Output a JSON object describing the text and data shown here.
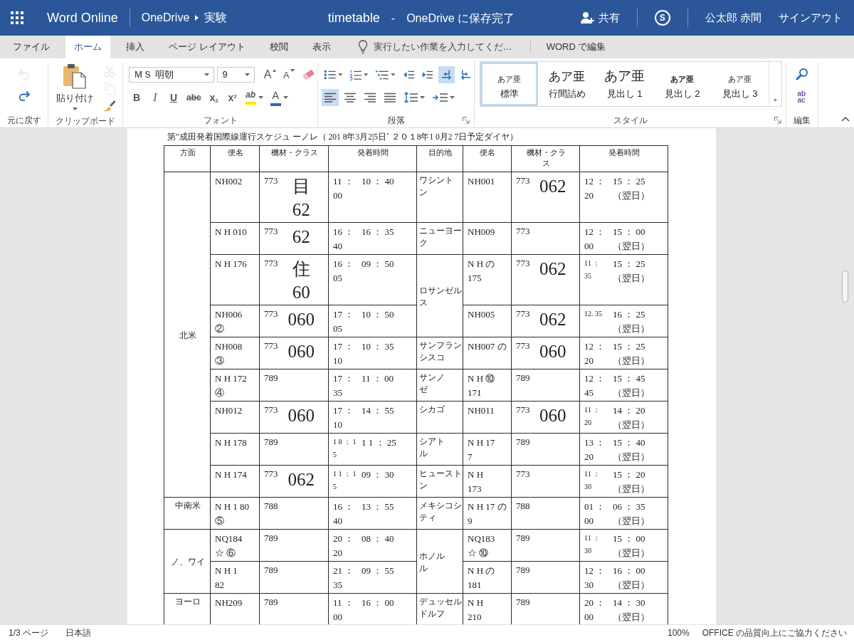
{
  "app_bar": {
    "app_name": "Word Online",
    "breadcrumb": [
      "OneDrive",
      "実験"
    ],
    "document_title": "timetable",
    "title_separator": "-",
    "save_status": "OneDrive に保存完了",
    "share": "共有",
    "chat_glyph": "S",
    "user_name": "公太郎 赤間",
    "sign_out": "サインアウト"
  },
  "tabs": [
    {
      "label": "ファイル",
      "selected": false
    },
    {
      "label": "ホーム",
      "selected": true
    },
    {
      "label": "挿入",
      "selected": false
    },
    {
      "label": "ページ レイアウト",
      "selected": false
    },
    {
      "label": "校閲",
      "selected": false
    },
    {
      "label": "表示",
      "selected": false
    }
  ],
  "tell_me": {
    "placeholder": "実行したい作業を入力してくだ…"
  },
  "edit_in_word": "WORD で編集",
  "ribbon": [
    {
      "kind": "undo",
      "label": "元に戻す",
      "buttons": [
        {
          "kind": "undo",
          "disabled": true
        },
        {
          "kind": "redo",
          "disabled": false
        }
      ]
    },
    {
      "kind": "clipboard",
      "label": "クリップボード",
      "paste": "貼り付け",
      "buttons": [
        {
          "kind": "cut",
          "disabled": true
        },
        {
          "kind": "copy",
          "disabled": true
        },
        {
          "kind": "painter",
          "disabled": false
        }
      ]
    },
    {
      "kind": "font",
      "label": "フォント",
      "font_name": "ＭＳ 明朝",
      "font_size": "9",
      "rows": [
        [
          {
            "kind": "grow",
            "glyph": "A",
            "selected": false
          },
          {
            "kind": "shrink",
            "glyph": "A",
            "selected": false
          },
          {
            "kind": "clear",
            "selected": false
          }
        ],
        [
          {
            "kind": "bold",
            "glyph": "B",
            "selected": false
          },
          {
            "kind": "italic",
            "glyph": "I",
            "selected": false
          },
          {
            "kind": "underline",
            "glyph": "U",
            "selected": false
          },
          {
            "kind": "strike",
            "glyph": "abc",
            "selected": false
          },
          {
            "kind": "subscript",
            "glyph": "x$_{2}$",
            "selected": false
          },
          {
            "kind": "superscript",
            "glyph": "x$^{2}$",
            "selected": false
          },
          {
            "kind": "highlight",
            "glyph": "ab",
            "selected": false
          },
          {
            "kind": "color",
            "glyph": "A",
            "selected": false
          }
        ]
      ]
    },
    {
      "kind": "paragraph",
      "label": "段落",
      "rows": [
        [
          {
            "kind": "bullets",
            "selected": false
          },
          {
            "kind": "numbering",
            "selected": false
          },
          {
            "kind": "multilevel",
            "selected": false
          },
          {
            "kind": "outdent",
            "selected": false
          },
          {
            "kind": "indent",
            "selected": false
          },
          {
            "kind": "ltr",
            "selected": true
          },
          {
            "kind": "rtl",
            "selected": false
          }
        ],
        [
          {
            "kind": "left",
            "selected": true
          },
          {
            "kind": "center",
            "selected": false
          },
          {
            "kind": "right",
            "selected": false
          },
          {
            "kind": "justify",
            "selected": false
          },
          {
            "kind": "linespacing",
            "selected": false
          },
          {
            "kind": "paraspacing",
            "selected": false
          }
        ]
      ]
    },
    {
      "kind": "styles",
      "label": "スタイル",
      "styles": [
        {
          "kind": "normal",
          "preview": "あア亜",
          "name": "標準",
          "selected": true
        },
        {
          "kind": "compact",
          "preview": "あア亜",
          "name": "行間詰め",
          "selected": false
        },
        {
          "kind": "heading1",
          "preview": "あア亜",
          "name": "見出し 1",
          "selected": false
        },
        {
          "kind": "heading2",
          "preview": "あア亜",
          "name": "見出し 2",
          "selected": false
        },
        {
          "kind": "heading3",
          "preview": "あア亜",
          "name": "見出し 3",
          "selected": false
        }
      ]
    },
    {
      "kind": "editing",
      "label": "編集",
      "buttons": [
        {
          "kind": "find"
        },
        {
          "kind": "replace",
          "glyph": "ab ac"
        }
      ]
    }
  ],
  "document": {
    "title": "第″成田発着国際線運行スケジュ ーノレ（ 201 8年3月2|5日˜ ２０１8年1 0月2 7日予定ダイヤ）",
    "columns": [
      [
        "方面"
      ],
      [
        "便名"
      ],
      [
        "機材・クラス"
      ],
      [
        "発着時間"
      ],
      [
        "目的地"
      ],
      [
        "便名"
      ],
      [
        "機材・クラ",
        "ス"
      ],
      [
        "発着時間"
      ]
    ],
    "regions": [
      {
        "name": "北米",
        "flights": [
          {
            "flight": "NH002",
            "aircraft": "773",
            "class": "目\n62",
            "dep": "11 ：\n00",
            "arr": "10 ： 40",
            "small": false
          },
          {
            "flight": "N H 010",
            "aircraft": "773",
            "class": "62",
            "dep": "16 ：\n40",
            "arr": "16 ： 35",
            "small": false
          },
          {
            "flight": "N H 176",
            "aircraft": "773",
            "class": "住\n60",
            "dep": "16 ：\n05",
            "arr": "09 ： 50",
            "small": false
          },
          {
            "flight": "NH006\n②",
            "aircraft": "773",
            "class": "060",
            "dep": "17 ：\n05",
            "arr": "10 ： 50",
            "small": false
          },
          {
            "flight": "NH008\n③",
            "aircraft": "773",
            "class": "060",
            "dep": "17 ：\n10",
            "arr": "10 ： 35",
            "small": false
          },
          {
            "flight": "N H 172\n④",
            "aircraft": "789",
            "dep": "17 ：\n35",
            "arr": "11 ： 00",
            "small": false
          },
          {
            "flight": "NH012",
            "aircraft": "773",
            "class": "060",
            "dep": "17 ：\n10",
            "arr": "14 ： 55",
            "small": false
          },
          {
            "flight": "N H 178",
            "aircraft": "789",
            "dep": "1 8 ： 1\n5",
            "arr": "1 1 ： 25",
            "small": true
          },
          {
            "flight": "N H 174",
            "aircraft": "773",
            "class": "062",
            "dep": "1 1 ： 1\n5",
            "arr": "09 ： 30",
            "small": true
          }
        ]
      },
      {
        "name": "中南米",
        "flights": [
          {
            "flight": "N H 1 80\n⑤",
            "aircraft": "788",
            "dep": "16 ：\n40",
            "arr": "13 ： 55",
            "small": false
          }
        ]
      },
      {
        "name": "ノ、ワイ",
        "flights": [
          {
            "flight": "NQ184\n☆ ⑥",
            "aircraft": "789",
            "dep": "20 ：\n20",
            "arr": "08 ： 40",
            "small": false
          },
          {
            "flight": "N H 1\n82",
            "aircraft": "789",
            "dep": "21 ：\n35",
            "arr": "09 ： 55",
            "small": false
          }
        ]
      },
      {
        "name": "ヨーロ",
        "flights": [
          {
            "flight": "NH209",
            "aircraft": "789",
            "dep": "11 ：\n00",
            "arr": "16 ： 00",
            "small": false
          }
        ]
      }
    ],
    "destinations": [
      {
        "name": [
          "ワシント",
          "ン"
        ],
        "flights": [
          {
            "flight": "NH001",
            "aircraft": "773",
            "class": "062",
            "dep": "12 ：\n20",
            "arr": "15 ： 25\n（翌日）",
            "small": false
          }
        ]
      },
      {
        "name": [
          "ニューヨー",
          "ク"
        ],
        "flights": [
          {
            "flight": "NH009",
            "aircraft": "773",
            "dep": "12 ：\n00",
            "arr": "15 ： 00\n（翌日）",
            "small": false
          }
        ]
      },
      {
        "name": [
          "ロサンゼル",
          "ス"
        ],
        "flights": [
          {
            "flight": "N H の\n175",
            "aircraft": "773",
            "class": "062",
            "dep": "11 ：\n35",
            "arr": "15 ： 25\n（翌日）",
            "small": true
          },
          {
            "flight": "NH005",
            "aircraft": "773",
            "class": "062",
            "dep": "12. 35",
            "arr": "16 ： 25\n（翌日）",
            "small": true
          }
        ]
      },
      {
        "name": [
          "サンフラン",
          "シスコ"
        ],
        "flights": [
          {
            "flight": "NH007 の",
            "aircraft": "773",
            "class": "060",
            "dep": "12 ：\n20",
            "arr": "15 ： 25\n（翌日）",
            "small": false
          }
        ]
      },
      {
        "name": [
          "サンノ",
          "ゼ"
        ],
        "flights": [
          {
            "flight": "N H ⑩\n171",
            "aircraft": "789",
            "dep": "12 ：\n45",
            "arr": "15 ： 45\n（翌日）",
            "small": false
          }
        ]
      },
      {
        "name": [
          "シカゴ"
        ],
        "flights": [
          {
            "flight": "NH011",
            "aircraft": "773",
            "class": "060",
            "dep": "11 ：\n20",
            "arr": "14 ： 20\n（翌日）",
            "small": true
          }
        ]
      },
      {
        "name": [
          "シアト",
          "ル"
        ],
        "flights": [
          {
            "flight": "N H 17\n7",
            "aircraft": "789",
            "dep": "13 ：\n20",
            "arr": "15 ： 40\n（翌日）",
            "small": false
          }
        ]
      },
      {
        "name": [
          "ヒュースト",
          "ン"
        ],
        "flights": [
          {
            "flight": "N H\n173",
            "aircraft": "773",
            "dep": "11 ：\n30",
            "arr": "15 ： 20\n（翌日）",
            "small": true
          }
        ]
      },
      {
        "name": [
          "メキシコシ",
          "ティ"
        ],
        "flights": [
          {
            "flight": "N H 17 の\n9",
            "aircraft": "788",
            "dep": "01 ：\n00",
            "arr": "06 ： 35\n（翌日）",
            "small": false
          }
        ]
      },
      {
        "name": [
          "ホノル",
          "ル"
        ],
        "flights": [
          {
            "flight": "NQ183\n☆ ⑩",
            "aircraft": "789",
            "dep": "11 ：\n30",
            "arr": "15 ： 00\n（翌日）",
            "small": true
          },
          {
            "flight": "N H の\n181",
            "aircraft": "789",
            "dep": "12 ：\n30",
            "arr": "16 ： 00\n（翌日）",
            "small": false
          }
        ]
      },
      {
        "name": [
          "デュッセル",
          "ドルフ"
        ],
        "flights": [
          {
            "flight": "N H\n210",
            "aircraft": "789",
            "dep": "20 ：\n00",
            "arr": "14 ： 30\n（翌日）",
            "small": false
          }
        ]
      }
    ]
  },
  "status_bar": {
    "page": "1/3 ページ",
    "language": "日本語",
    "zoom": "100%",
    "feedback": "OFFICE の品質向上にご協力ください"
  }
}
